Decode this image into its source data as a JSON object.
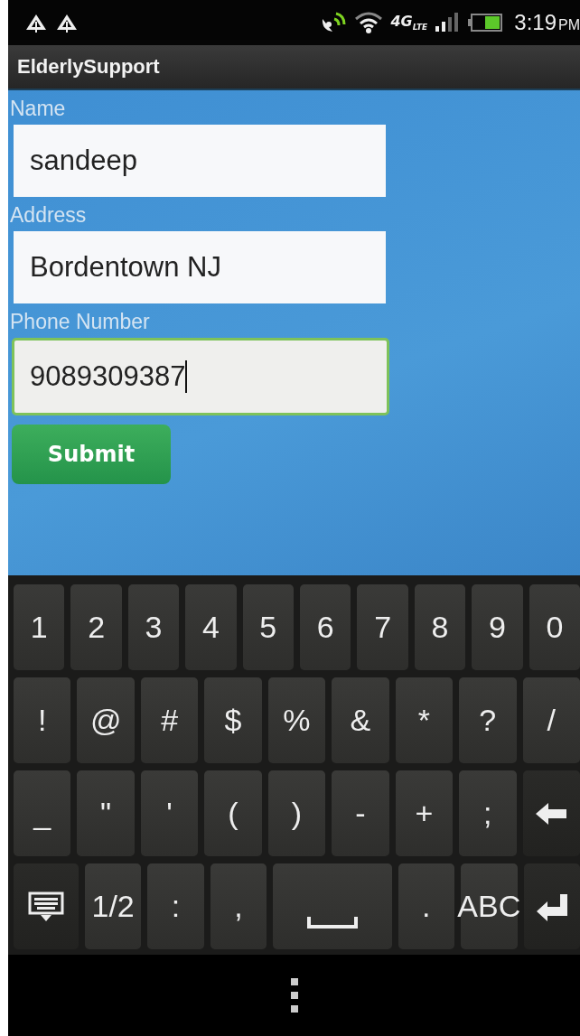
{
  "status_bar": {
    "network": "4G",
    "network_sub": "LTE",
    "time": "3:19",
    "ampm": "PM"
  },
  "action_bar": {
    "title": "ElderlySupport"
  },
  "fields": [
    {
      "label": "Name",
      "value": "sandeep",
      "focused": false
    },
    {
      "label": "Address",
      "value": "Bordentown NJ",
      "focused": false
    },
    {
      "label": "Phone Number",
      "value": "9089309387",
      "focused": true
    }
  ],
  "submit_button": {
    "label": "Submit"
  },
  "keyboard": {
    "number_keys": [
      {
        "kind": "char",
        "label": "1"
      },
      {
        "kind": "char",
        "label": "2"
      },
      {
        "kind": "char",
        "label": "3"
      },
      {
        "kind": "char",
        "label": "4"
      },
      {
        "kind": "char",
        "label": "5"
      },
      {
        "kind": "char",
        "label": "6"
      },
      {
        "kind": "char",
        "label": "7"
      },
      {
        "kind": "char",
        "label": "8"
      },
      {
        "kind": "char",
        "label": "9"
      },
      {
        "kind": "char",
        "label": "0"
      }
    ],
    "symbol_keys": [
      {
        "kind": "char",
        "label": "!"
      },
      {
        "kind": "char",
        "label": "@"
      },
      {
        "kind": "char",
        "label": "#"
      },
      {
        "kind": "char",
        "label": "$"
      },
      {
        "kind": "char",
        "label": "%"
      },
      {
        "kind": "char",
        "label": "&"
      },
      {
        "kind": "char",
        "label": "*"
      },
      {
        "kind": "char",
        "label": "?"
      },
      {
        "kind": "char",
        "label": "/"
      }
    ],
    "punctuation_keys": [
      {
        "kind": "char",
        "label": "_"
      },
      {
        "kind": "char",
        "label": "\""
      },
      {
        "kind": "char",
        "label": "'"
      },
      {
        "kind": "char",
        "label": "("
      },
      {
        "kind": "char",
        "label": ")"
      },
      {
        "kind": "char",
        "label": "-"
      },
      {
        "kind": "char",
        "label": "+"
      },
      {
        "kind": "char",
        "label": ";"
      },
      {
        "kind": "backspace"
      }
    ],
    "bottom_keys": [
      {
        "kind": "hide"
      },
      {
        "kind": "char",
        "label": "1/2"
      },
      {
        "kind": "char",
        "label": ":"
      },
      {
        "kind": "char",
        "label": ","
      },
      {
        "kind": "space"
      },
      {
        "kind": "char",
        "label": "."
      },
      {
        "kind": "char",
        "label": "ABC"
      },
      {
        "kind": "enter"
      }
    ]
  }
}
